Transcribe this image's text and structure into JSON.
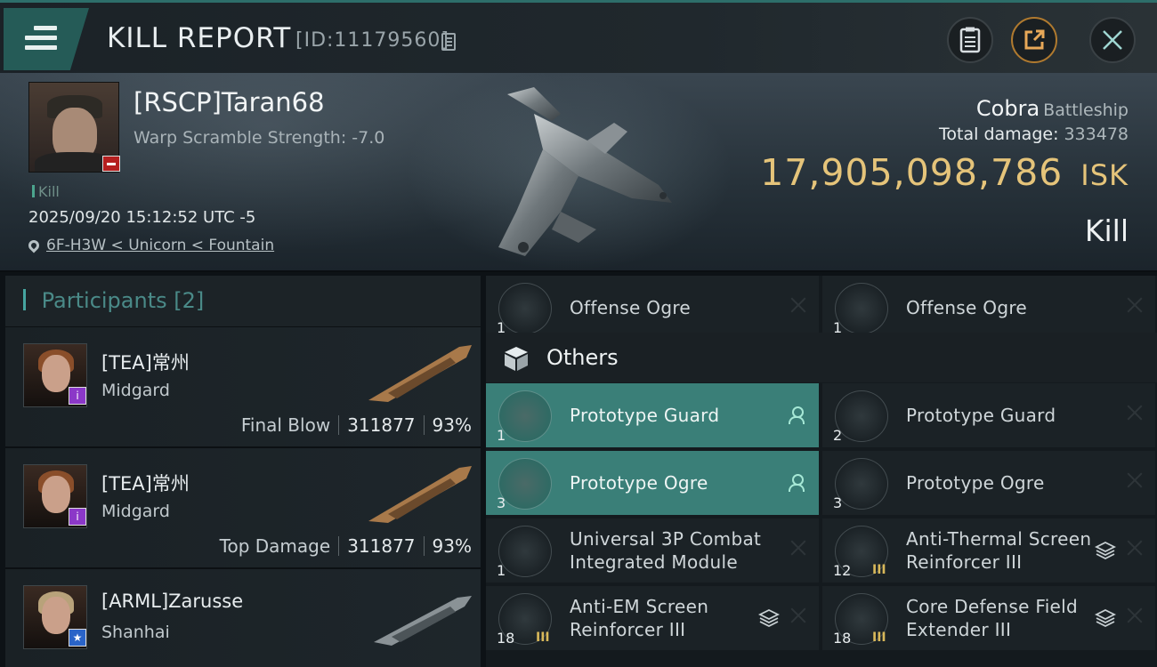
{
  "header": {
    "title": "KILL REPORT",
    "report_id": "[ID:11179560]",
    "menu_icon": "hamburger-menu-icon",
    "buttons": [
      "clipboard-icon",
      "share-icon",
      "close-icon"
    ]
  },
  "victim": {
    "name": "[RSCP]Taran68",
    "warp_scramble": "Warp Scramble Strength: -7.0",
    "kill_tag": "Kill",
    "datetime": "2025/09/20 15:12:52 UTC -5",
    "location": "6F-H3W < Unicorn < Fountain",
    "ship_name": "Cobra",
    "ship_class": "Battleship",
    "total_damage_label": "Total damage:",
    "total_damage": "333478",
    "isk_value": "17,905,098,786",
    "isk_unit": "ISK",
    "result": "Kill"
  },
  "participants": {
    "title": "Participants",
    "count": "[2]",
    "rows": [
      {
        "name": "[TEA]常州",
        "ship": "Midgard",
        "label": "Final Blow",
        "damage": "311877",
        "percent": "93%"
      },
      {
        "name": "[TEA]常州",
        "ship": "Midgard",
        "label": "Top Damage",
        "damage": "311877",
        "percent": "93%"
      },
      {
        "name": "[ARML]Zarusse",
        "ship": "Shanhai"
      }
    ]
  },
  "modules": {
    "top_row": [
      {
        "name": "Offense  Ogre",
        "qty": "1"
      },
      {
        "name": "Offense  Ogre",
        "qty": "1"
      }
    ],
    "others_label": "Others",
    "items": [
      {
        "name": "Prototype  Guard",
        "qty": "1"
      },
      {
        "name": "Prototype  Guard",
        "qty": "2"
      },
      {
        "name": "Prototype  Ogre",
        "qty": "3"
      },
      {
        "name": "Prototype  Ogre",
        "qty": "3"
      },
      {
        "name": "Universal 3P Combat Integrated Module",
        "qty": "1"
      },
      {
        "name": "Anti-Thermal Screen Reinforcer III",
        "qty": "12"
      },
      {
        "name": "Anti-EM Screen Reinforcer III",
        "qty": "18"
      },
      {
        "name": "Core Defense Field Extender III",
        "qty": "18"
      }
    ]
  },
  "colors": {
    "accent_teal": "#3a7f78",
    "isk_gold": "#e5c47a",
    "kill_red": "#b51f1f"
  }
}
